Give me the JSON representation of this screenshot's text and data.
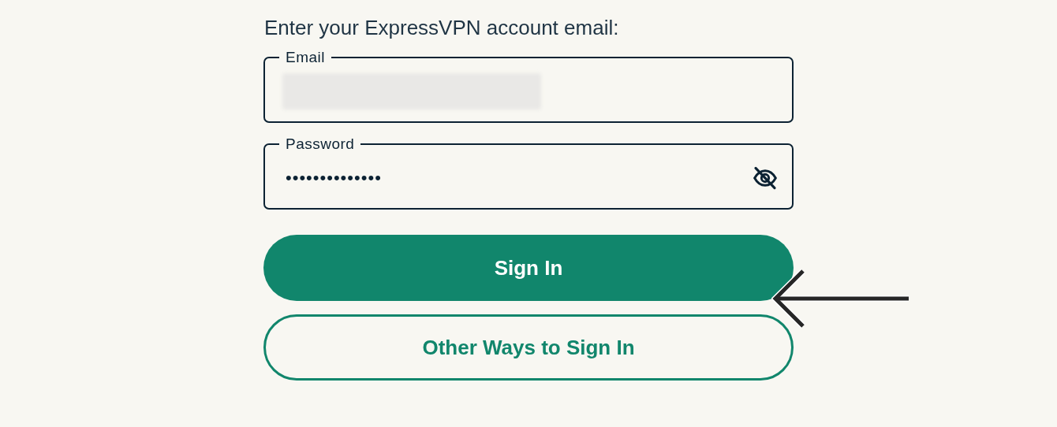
{
  "prompt": "Enter your ExpressVPN account email:",
  "email_field": {
    "label": "Email",
    "value_redacted": true
  },
  "password_field": {
    "label": "Password",
    "value": "••••••••••••••",
    "password_visible": false
  },
  "buttons": [
    {
      "label": "Sign In",
      "kind": "primary"
    },
    {
      "label": "Other Ways to Sign In",
      "kind": "outline"
    }
  ],
  "annotation": {
    "kind": "arrow"
  }
}
